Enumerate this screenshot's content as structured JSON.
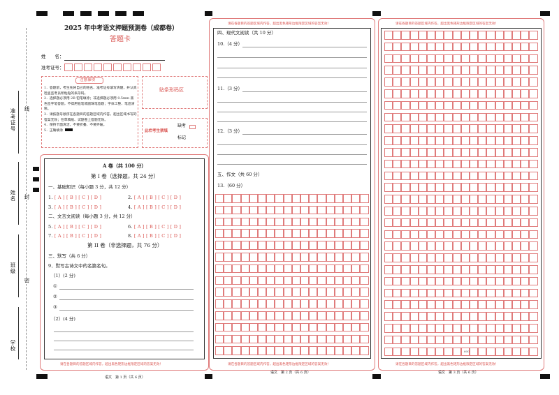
{
  "header": {
    "title": "2025 年中考语文押题预测卷（成都卷）",
    "subtitle": "答题卡"
  },
  "student": {
    "name_label": "姓　　名：",
    "ticket_label": "准考证号："
  },
  "notice": {
    "title": "注意事项",
    "items": [
      "1．答题前，考生先将自己的姓名、准考证号填写清楚，并认真检查监考员所粘贴的条形码。",
      "2．选择题必须用 2B 铅笔填涂；非选择题必须用 0.5mm 黑色签字笔答题，不得用铅笔或圆珠笔答题；字体工整、笔迹清晰。",
      "3．请按题号顺序在各题目的答题区域内作答，超出区域书写的答案无效；在草稿纸、试题卷上答题无效。",
      "4．保持卡面清洁，不要折叠、不要弄破。",
      "5．正确填涂"
    ]
  },
  "barcode_label": "贴条形码区",
  "absent": {
    "label": "此栏考生禁填",
    "mark1": "缺考",
    "mark2": "标记"
  },
  "side": {
    "ticket": "准考证号",
    "name": "姓名",
    "class": "班级",
    "school": "学校",
    "line": "线",
    "seal": "封",
    "secret": "密"
  },
  "section_a": {
    "title": "A 卷（共 100 分）",
    "part1": "第 I 卷（选择题，共 24 分）",
    "q_group1": "一、基础知识（每小题 3 分，共 12 分）",
    "q_group2": "二、文言文阅读（每小题 3 分，共 12 分）",
    "part2": "第 II 卷（非选择题，共 76 分）",
    "q_group3": "三、默写（共 6 分）",
    "q9": "9．默写古诗文中的名篇名句。",
    "q9_1": "（1）(2 分)",
    "q9_2": "（2）(4 分)",
    "circ1": "①",
    "circ2": "②",
    "circ3": "③"
  },
  "choices": {
    "options": "[ A ] [ B ] [ C ] [ D ]",
    "nums": [
      "1.",
      "2.",
      "3.",
      "4.",
      "5.",
      "6.",
      "7.",
      "8."
    ]
  },
  "page2": {
    "group4": "四、现代文阅读（共 10 分）",
    "q10": "10.（4 分）",
    "q11": "11.（3 分）",
    "q12": "12.（3 分）",
    "group5": "五、作文（共 60 分）",
    "q13": "13.（60 分）"
  },
  "page3": {
    "count_mark": "600"
  },
  "warning": "请在各题目的答题区域内作答，超出黑色矩形边框限定区域的答案无效！",
  "footers": [
    "语文　第 1 页（共 6 页）",
    "语文　第 2 页（共 6 页）",
    "语文　第 3 页（共 6 页）"
  ]
}
